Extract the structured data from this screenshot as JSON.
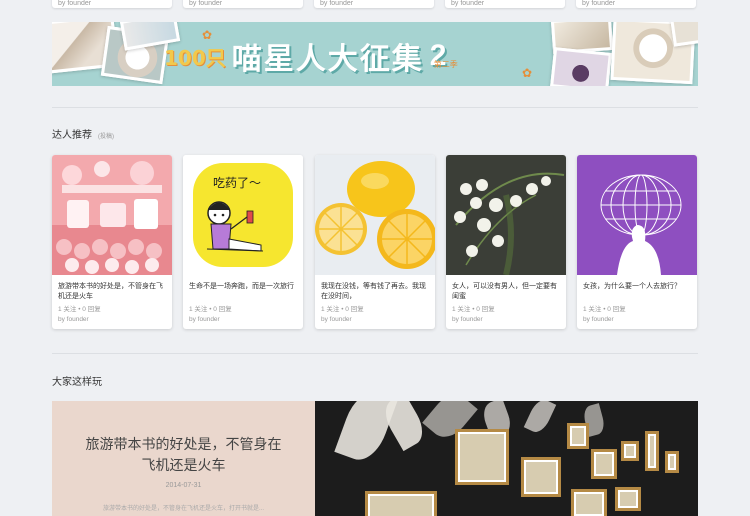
{
  "top_cards": [
    {
      "meta": "by founder"
    },
    {
      "meta": "by founder"
    },
    {
      "meta": "by founder"
    },
    {
      "meta": "by founder"
    },
    {
      "meta": "by founder"
    }
  ],
  "banner": {
    "count": "100只",
    "title": "喵星人大征集",
    "edition_number": "2",
    "edition_label": "第二季"
  },
  "experts": {
    "heading": "达人推荐",
    "subheading": "(投稿)",
    "cards": [
      {
        "title": "旅游带本书的好处是，不管身在飞机还是火车",
        "stats": "1 关注 • 0 回复",
        "author": "by founder"
      },
      {
        "title": "生命不是一场奔跑，而是一次旅行",
        "stats": "1 关注 • 0 回复",
        "author": "by founder",
        "image_text": "吃药了～"
      },
      {
        "title": "我现在没钱，等有钱了再去。我现在没时间，",
        "stats": "1 关注 • 0 回复",
        "author": "by founder"
      },
      {
        "title": "女人，可以没有男人，但一定要有闺蜜",
        "stats": "1 关注 • 0 回复",
        "author": "by founder"
      },
      {
        "title": "女孩，为什么要一个人去旅行？",
        "stats": "1 关注 • 0 回复",
        "author": "by founder"
      }
    ]
  },
  "featured": {
    "heading": "大家这样玩",
    "title": "旅游带本书的好处是，不管身在飞机还是火车",
    "date": "2014-07-31",
    "excerpt": "旅游带本书的好处是，不管身在飞机还是火车，打开书就是..."
  }
}
